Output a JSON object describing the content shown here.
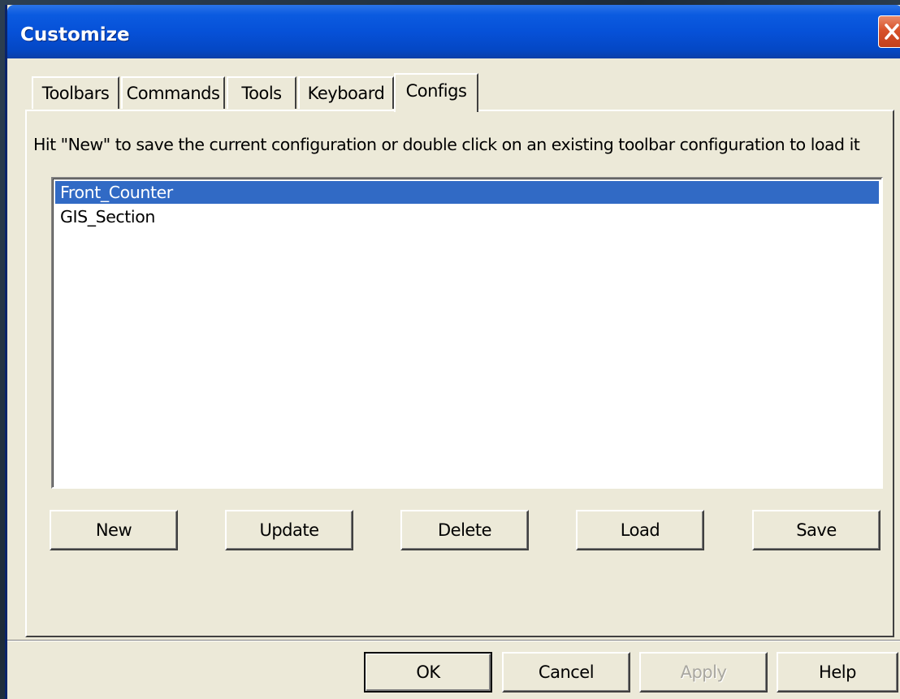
{
  "window": {
    "title": "Customize"
  },
  "tabs": [
    {
      "label": "Toolbars",
      "active": false
    },
    {
      "label": "Commands",
      "active": false
    },
    {
      "label": "Tools",
      "active": false
    },
    {
      "label": "Keyboard",
      "active": false
    },
    {
      "label": "Configs",
      "active": true
    }
  ],
  "configs": {
    "hint": "Hit \"New\" to save the current configuration or double click on an existing toolbar configuration to load it",
    "items": [
      {
        "label": "Front_Counter",
        "selected": true
      },
      {
        "label": "GIS_Section",
        "selected": false
      }
    ],
    "buttons": {
      "new": "New",
      "update": "Update",
      "delete": "Delete",
      "load": "Load",
      "save": "Save"
    }
  },
  "footer": {
    "ok": "OK",
    "cancel": "Cancel",
    "apply": "Apply",
    "help": "Help"
  },
  "colors": {
    "titlebar": "#0651d8",
    "selection": "#316ac5",
    "dialog": "#ece9d8",
    "close": "#d8522a"
  },
  "icons": {
    "close": "close-icon"
  }
}
